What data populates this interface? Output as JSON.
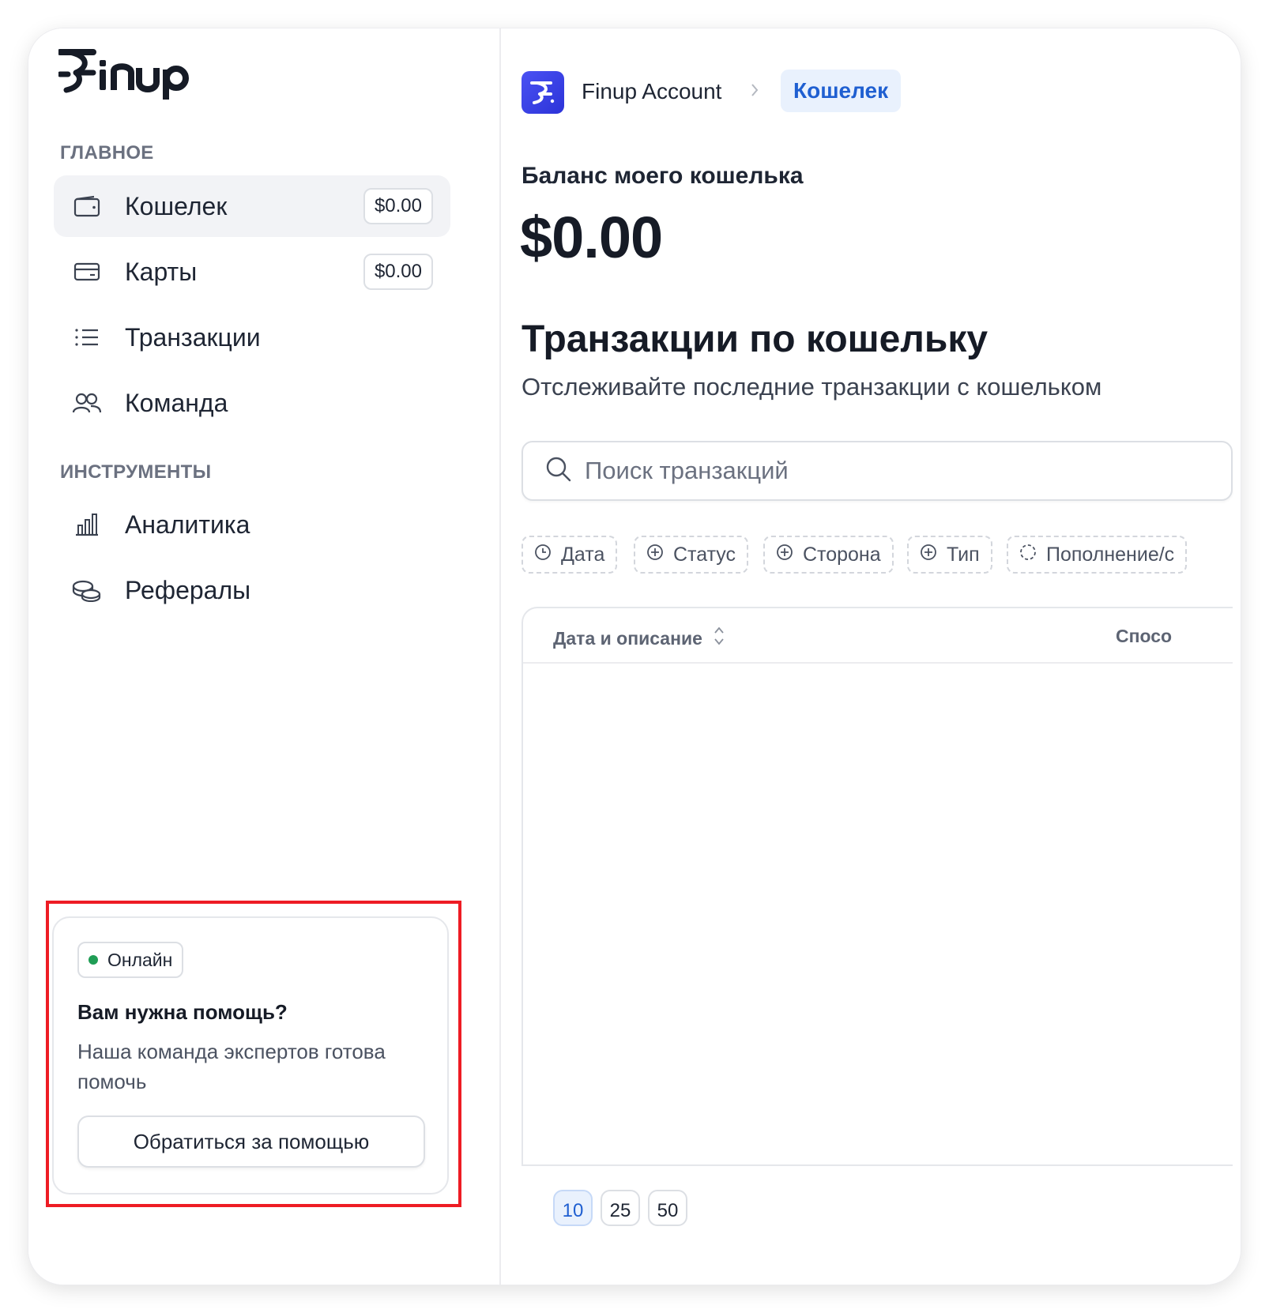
{
  "brand": {
    "logo_text": "Finup"
  },
  "sidebar": {
    "section_main": "ГЛАВНОЕ",
    "section_tools": "ИНСТРУМЕНТЫ",
    "items": [
      {
        "label": "Кошелек",
        "badge": "$0.00",
        "icon": "wallet-icon",
        "active": true
      },
      {
        "label": "Карты",
        "badge": "$0.00",
        "icon": "card-icon"
      },
      {
        "label": "Транзакции",
        "icon": "list-icon"
      },
      {
        "label": "Команда",
        "icon": "team-icon"
      },
      {
        "label": "Аналитика",
        "icon": "chart-icon"
      },
      {
        "label": "Рефералы",
        "icon": "coins-icon"
      }
    ],
    "help": {
      "status": "Онлайн",
      "status_color": "#1f9d55",
      "title": "Вам нужна помощь?",
      "text": "Наша команда экспертов готова помочь",
      "button": "Обратиться за помощью"
    }
  },
  "breadcrumb": {
    "account": "Finup Account",
    "current": "Кошелек"
  },
  "balance": {
    "label": "Баланс моего кошелька",
    "value": "$0.00"
  },
  "transactions": {
    "title": "Транзакции по кошельку",
    "subtitle": "Отслеживайте последние транзакции с кошельком",
    "search_placeholder": "Поиск транзакций",
    "filters": [
      "Дата",
      "Статус",
      "Сторона",
      "Тип",
      "Пополнение/с"
    ],
    "columns": [
      "Дата и описание",
      "Спосо"
    ],
    "page_sizes": [
      "10",
      "25",
      "50"
    ],
    "selected_page_size": "10"
  },
  "colors": {
    "accent": "#1f5fd1",
    "brand": "#3b42e8",
    "highlight": "#ee1c24"
  }
}
